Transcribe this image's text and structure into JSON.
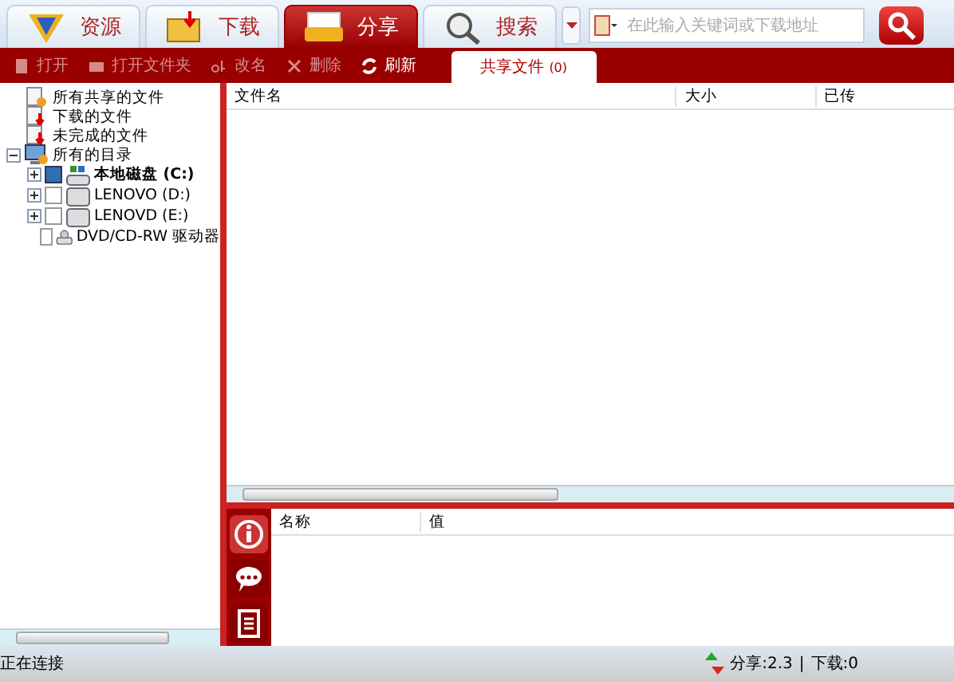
{
  "nav_tabs": [
    {
      "label": "资源",
      "kind": "shield",
      "selected": false
    },
    {
      "label": "下载",
      "kind": "folder",
      "selected": false
    },
    {
      "label": "分享",
      "kind": "drawer",
      "selected": true
    },
    {
      "label": "搜索",
      "kind": "magnifier",
      "selected": false
    }
  ],
  "search": {
    "placeholder": "在此输入关键词或下载地址"
  },
  "toolbar": [
    {
      "label": "打开",
      "kind": "doc",
      "disabled": true
    },
    {
      "label": "打开文件夹",
      "kind": "folder",
      "disabled": true
    },
    {
      "label": "改名",
      "kind": "rename",
      "disabled": true
    },
    {
      "label": "删除",
      "kind": "delete",
      "disabled": true
    },
    {
      "label": "刷新",
      "kind": "refresh",
      "disabled": false
    }
  ],
  "content_tabs": [
    {
      "label": "共享文件",
      "count": "(0)",
      "selected": true
    }
  ],
  "tree": [
    {
      "label": "所有共享的文件",
      "kind": "share"
    },
    {
      "label": "下载的文件",
      "kind": "download"
    },
    {
      "label": "未完成的文件",
      "kind": "partial"
    },
    {
      "label": "所有的目录",
      "kind": "computer",
      "expanded": true,
      "children": [
        {
          "label": "本地磁盘 (C:)",
          "kind": "system",
          "expanded": false,
          "checked": true
        },
        {
          "label": "LENOVO (D:)",
          "kind": "drive",
          "expanded": false,
          "checked": false
        },
        {
          "label": "LENOVD (E:)",
          "kind": "drive",
          "expanded": false,
          "checked": false
        },
        {
          "label": "DVD/CD-RW 驱动器",
          "kind": "dvd",
          "checked": false
        }
      ]
    }
  ],
  "file_table": {
    "columns": [
      "文件名",
      "大小",
      "已传"
    ]
  },
  "properties": {
    "columns": [
      "名称",
      "值"
    ]
  },
  "side_buttons": [
    {
      "kind": "info",
      "selected": true
    },
    {
      "kind": "chat",
      "selected": false
    },
    {
      "kind": "list",
      "selected": false
    }
  ],
  "status_bar": {
    "text": "正在连接",
    "share": "分享:2.3",
    "separator": "|",
    "download": "下载:0"
  }
}
